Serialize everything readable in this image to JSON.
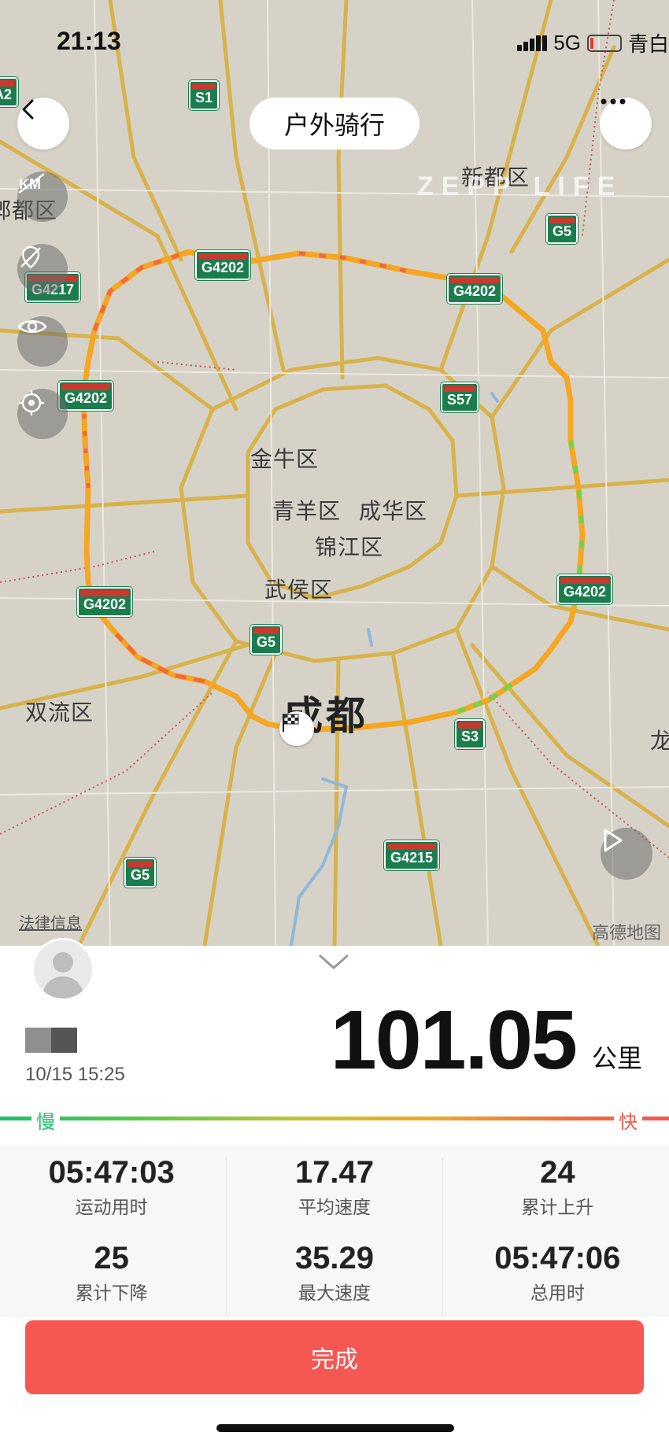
{
  "status_bar": {
    "time": "21:13",
    "network": "5G",
    "carrier": "青白"
  },
  "header": {
    "title": "户外骑行",
    "back_icon": "chevron-left-icon",
    "more_icon": "more-icon"
  },
  "map": {
    "watermark": "ZEPP LIFE",
    "legal": "法律信息",
    "provider": "高德地图",
    "tools": [
      "km-marker-icon",
      "hide-location-icon",
      "eye-icon",
      "locate-icon"
    ],
    "play_icon": "play-icon",
    "finish_icon": "checkered-flag-icon",
    "districts": [
      "新都区",
      "金牛区",
      "青羊区",
      "成华区",
      "锦江区",
      "武侯区",
      "双流区",
      "成都",
      "郫都区",
      "龙",
      "A2"
    ],
    "roads": [
      "S1",
      "G5",
      "G4217",
      "G4202",
      "G4202",
      "G4202",
      "S57",
      "G4202",
      "G4202",
      "G5",
      "S3",
      "G5",
      "G4215"
    ]
  },
  "workout": {
    "user_name_colors": [
      "#8f8f8f",
      "#555555"
    ],
    "date": "10/15 15:25",
    "distance": "101.05",
    "distance_unit": "公里",
    "speed_slow": "慢",
    "speed_fast": "快",
    "stats": [
      {
        "value": "05:47:03",
        "label": "运动用时"
      },
      {
        "value": "17.47",
        "label": "平均速度"
      },
      {
        "value": "24",
        "label": "累计上升"
      },
      {
        "value": "25",
        "label": "累计下降"
      },
      {
        "value": "35.29",
        "label": "最大速度"
      },
      {
        "value": "05:47:06",
        "label": "总用时"
      }
    ]
  },
  "actions": {
    "done": "完成"
  },
  "colors": {
    "accent": "#f55753",
    "slow": "#1fbf6a",
    "fast": "#f25a4f",
    "route": "#f5a623"
  }
}
